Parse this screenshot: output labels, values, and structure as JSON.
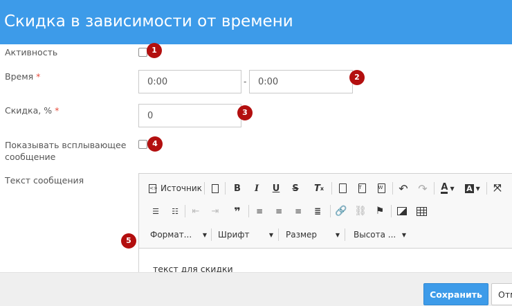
{
  "dialog": {
    "title": "Скидка в зависимости от времени"
  },
  "fields": {
    "active": {
      "label": "Активность",
      "checked": false,
      "badge": "1"
    },
    "time": {
      "label": "Время",
      "required_mark": "*",
      "from": "0:00",
      "separator": "-",
      "to": "0:00",
      "badge": "2"
    },
    "discount": {
      "label": "Скидка, %",
      "required_mark": "*",
      "value": "0",
      "badge": "3"
    },
    "popup": {
      "label_line1": "Показывать всплывающее",
      "label_line2": "сообщение",
      "checked": false,
      "badge": "4"
    },
    "message": {
      "label": "Текст сообщения",
      "badge": "5"
    }
  },
  "editor": {
    "source_label": "Источник",
    "combos": {
      "format": "Формат...",
      "font": "Шрифт",
      "size": "Размер",
      "height": "Высота ..."
    },
    "content": "текст для скидки",
    "icons": [
      "source-icon",
      "document-icon",
      "bold-icon",
      "italic-icon",
      "underline-icon",
      "strikethrough-icon",
      "remove-format-icon",
      "paste-icon",
      "paste-text-icon",
      "paste-word-icon",
      "undo-icon",
      "redo-icon",
      "text-color-icon",
      "bg-color-icon",
      "maximize-icon",
      "numbered-list-icon",
      "bulleted-list-icon",
      "outdent-icon",
      "indent-icon",
      "blockquote-icon",
      "align-left-icon",
      "align-center-icon",
      "align-right-icon",
      "justify-icon",
      "link-icon",
      "unlink-icon",
      "anchor-icon",
      "image-icon",
      "table-icon"
    ]
  },
  "footer": {
    "save_label": "Сохранить",
    "cancel_label": "Отм"
  },
  "colors": {
    "primary": "#3d9be9",
    "badge": "#b30f0f",
    "required": "#e74c3c"
  }
}
